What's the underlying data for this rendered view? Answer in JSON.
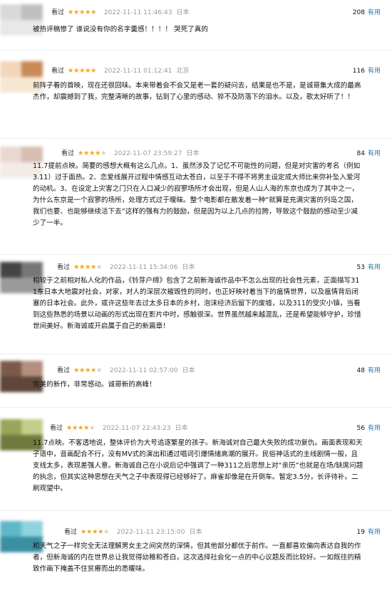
{
  "useful_label": "有用",
  "reviews": [
    {
      "user": "",
      "action": "看过",
      "rating": 5,
      "time": "2022-11-11 11:46:43",
      "location": "日本",
      "useful_count": "208",
      "content": "被热评稿惨了 谁说没有你的名字羹感！！！！ 哭死了真的",
      "avatar_colors": [
        "#d9d9d9",
        "#bfbfbf",
        "#e8e8e8"
      ]
    },
    {
      "user": "",
      "action": "看过",
      "rating": 5,
      "time": "2022-11-11 01:12:41",
      "location": "北京",
      "useful_count": "116",
      "content": "前阵子看的首映，现在还很回味。本来带着会不会又是老一套的疑问去，结果是也不是，是诚哥集大成的最高杰作，却震撼到了我，完整清晰的故事，钻到了心里的感动、猝不及防落下的泪水。以及，歌太好听了！！",
      "avatar_colors": [
        "#f2d6b8",
        "#c98a5a",
        "#f6e7d3"
      ]
    },
    {
      "user": "",
      "action": "看过",
      "rating": 4,
      "time": "2022-11-07 23:59:27",
      "location": "日本",
      "useful_count": "84",
      "content": "11.7提前点映。简要的感想大概有这么几点。1、虽然涉及了记忆不可能性的问题，但是对灾害的考名（例如3.11）过于面热。2、恋爱线展开过程中情感互动太苍白，以至于不得不将男主设定成大师比来弥补坠入爱河的动机。3、在设定上灾害之门只在人口减少的寂寥场所才会出现，但是人山人海的东京也成为了其中之一，为什么东京是一个寂寥的场所，处理方式过于暧昧。整个电影都在散发着一种“就算是充满灾害的列岛之国，我们也要、也能够继续活下去”这样的强有力的鼓励，但是因为以上几点的拉胯，导致这个鼓励的感动至少减少了一半。",
      "avatar_colors": [
        "#ead7d0",
        "#d8bdb3",
        "#f4ebe7"
      ]
    },
    {
      "user": "",
      "action": "看过",
      "rating": 4,
      "time": "2022-11-11 15:34:06",
      "location": "日本",
      "useful_count": "53",
      "content": "相较于之前相对私人化的作品，《铃芽户缔》包含了之前新海诚作品中不怎么出现的社会性元素，正面描写311东日本大地震对社会，对家，对人的深层次摧毁性的同时，也正好映衬着当下的瘟情世界，以及瘟情背后闭塞的日本社会。此外，或许这些年去过太多日本的乡村，泡沫经济后留下的废墟，以及311的受灾小镇，当看到这些熟悉的场景以动画的形式出现在影片中时，感触很深。世界虽然越来越混乱，还是希望能够守护，珍惜世间美好。新海诚或开启属于自己的新篇章！",
      "avatar_colors": [
        "#444444",
        "#777777",
        "#9a9a9a"
      ]
    },
    {
      "user": "",
      "action": "看过",
      "rating": 4,
      "time": "2022-11-11 02:57:00",
      "location": "日本",
      "useful_count": "48",
      "content": "完美的新作，非常感动。诚哥新的高峰！",
      "avatar_colors": [
        "#7a5a4a",
        "#b58f7c",
        "#5e463a"
      ]
    },
    {
      "user": "",
      "action": "看过",
      "rating": 4,
      "time": "2022-11-07 22:43:23",
      "location": "日本",
      "useful_count": "56",
      "content": "11.7点映。不客透地说，整体评价为大号追逐繁星的孩子。新海诚对自己最大失败的成功复仇。画面表现和天子适中，音画配合不行，没有MV式的演出和通过唱词引爆情绪高潮的展开。民俗神话式的主线剧情一般，且支线太多，表现差强人意。新海诚自己在小说后记中强调了一种311之后思想上对“亲历”也就是在场/缺席问题的执念，但其实这种思想在天气之子中表现得已经够好了。麻雀却像是在开倒车。暂定3.5分，长评待补。二刷观望中。",
      "avatar_colors": [
        "#9aa55a",
        "#c4cc8a",
        "#6f7a3e"
      ]
    },
    {
      "user": "",
      "action": "看过",
      "rating": 4,
      "time": "2022-11-11 23:15:00",
      "location": "日本",
      "useful_count": "19",
      "content": "和天气之子一样完全无法理解男女主之间突然的深情，但其他部分都优于前作。一直都喜欢偏向表达自我的作者，但新海诚的内在世界总让我觉得幼稚和苍白，这次选择社会化一点的中心议题反而比较好。一如既往的精致作画下掩盖不住贫瘠而出的悉暖味。",
      "avatar_colors": [
        "#5fb8c9",
        "#8fd3de",
        "#3a8fa3"
      ]
    }
  ]
}
